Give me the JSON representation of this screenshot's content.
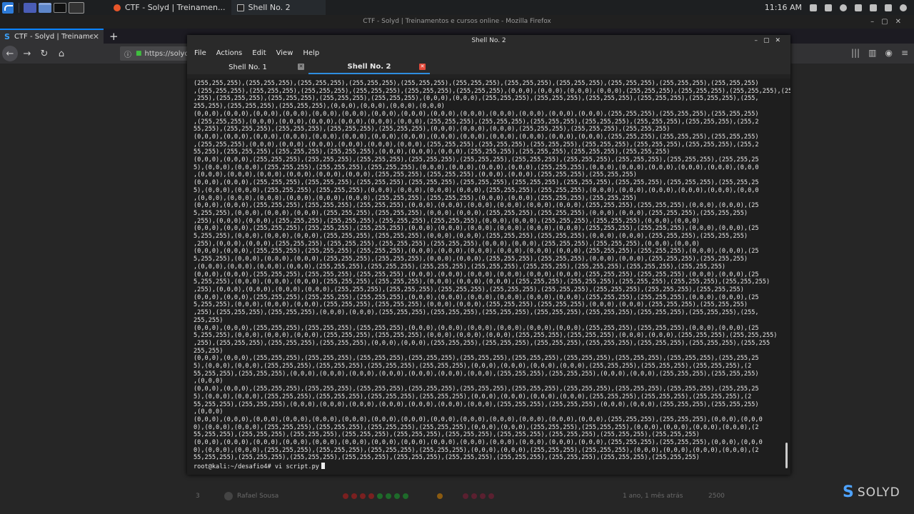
{
  "panel": {
    "tasks": [
      {
        "label": "CTF - Solyd | Treinamen...",
        "icon": "firefox-icon"
      },
      {
        "label": "Shell No. 2",
        "icon": "terminal-icon"
      }
    ],
    "clock": "11:16 AM"
  },
  "firefox": {
    "window_title": "CTF - Solyd | Treinamentos e cursos online - Mozilla Firefox",
    "tab_label": "CTF - Solyd | Treinamen",
    "url": "https://solyd.c",
    "content_row": {
      "rank": "3",
      "user": "Rafael Sousa",
      "time": "1 ano, 1 mês atrás",
      "score": "2500"
    },
    "logo_text": "SOLYD"
  },
  "terminal": {
    "window_title": "Shell No. 2",
    "menu": [
      "File",
      "Actions",
      "Edit",
      "View",
      "Help"
    ],
    "tabs": [
      {
        "label": "Shell No. 1",
        "active": false
      },
      {
        "label": "Shell No. 2",
        "active": true
      }
    ],
    "output": "(255,255,255),(255,255,255),(255,255,255),(255,255,255),(255,255,255),(255,255,255),(255,255,255),(255,255,255),(255,255,255),(255,255,255),(255,255,255)\n,(255,255,255),(255,255,255),(255,255,255),(255,255,255),(255,255,255),(255,255,255),(0,0,0),(0,0,0),(0,0,0),(0,0,0),(255,255,255),(255,255,255),(255,255,255),(255,255\n,255),(255,255,255),(255,255,255),(255,255,255),(255,255,255),(0,0,0),(0,0,0),(255,255,255),(255,255,255),(255,255,255),(255,255,255),(255,255,255),(255,\n255,255),(255,255,255),(255,255,255),(0,0,0),(0,0,0),(0,0,0),(0,0,0)\n(0,0,0),(0,0,0),(0,0,0),(0,0,0),(0,0,0),(0,0,0),(0,0,0),(0,0,0),(0,0,0),(0,0,0),(0,0,0),(0,0,0),(0,0,0),(0,0,0),(255,255,255),(255,255,255),(255,255,255)\n,(255,255,255),(0,0,0),(0,0,0),(0,0,0),(0,0,0),(0,0,0),(0,0,0),(255,255,255),(255,255,255),(255,255,255),(255,255,255),(255,255,255),(255,255,255),(255,2\n55,255),(255,255,255),(255,255,255),(255,255,255),(255,255,255),(0,0,0),(0,0,0),(0,0,0),(255,255,255),(255,255,255),(255,255,255)\n(0,0,0),(0,0,0),(0,0,0),(0,0,0),(0,0,0),(0,0,0),(0,0,0),(0,0,0),(0,0,0),(0,0,0),(0,0,0),(0,0,0),(0,0,0),(0,0,0),(255,255,255),(255,255,255),(255,255,255)\n,(255,255,255),(0,0,0),(0,0,0),(0,0,0),(0,0,0),(0,0,0),(0,0,0),(255,255,255),(255,255,255),(255,255,255),(255,255,255),(255,255,255),(255,255,255),(255,2\n55,255),(255,255,255),(255,255,255),(255,255,255),(0,0,0),(0,0,0),(0,0,0),(255,255,255),(255,255,255),(255,255,255),(255,255,255)\n(0,0,0),(0,0,0),(255,255,255),(255,255,255),(255,255,255),(255,255,255),(255,255,255),(255,255,255),(255,255,255),(255,255,255),(255,255,255),(255,255,25\n5),(0,0,0),(0,0,0),(255,255,255),(255,255,255),(255,255,255),(0,0,0),(0,0,0),(0,0,0),(0,0,0),(255,255,255),(0,0,0),(0,0,0),(0,0,0),(0,0,0),(0,0,0),(0,0,0\n,(0,0,0),(0,0,0),(0,0,0),(0,0,0),(0,0,0),(0,0,0),(255,255,255),(255,255,255),(0,0,0),(0,0,0),(255,255,255),(255,255,255)\n(0,0,0),(0,0,0),(255,255,255),(255,255,255),(255,255,255),(255,255,255),(255,255,255),(255,255,255),(255,255,255),(255,255,255),(255,255,255),(255,255,25\n5),(0,0,0),(0,0,0),(255,255,255),(255,255,255),(0,0,0),(0,0,0),(0,0,0),(0,0,0),(255,255,255),(255,255,255),(0,0,0),(0,0,0),(0,0,0),(0,0,0),(0,0,0),(0,0,0\n,(0,0,0),(0,0,0),(0,0,0),(0,0,0),(0,0,0),(0,0,0),(255,255,255),(255,255,255),(0,0,0),(0,0,0),(255,255,255),(255,255,255)\n(0,0,0),(0,0,0),(255,255,255),(255,255,255),(255,255,255),(0,0,0),(0,0,0),(0,0,0),(0,0,0),(0,0,0),(0,0,0),(255,255,255),(255,255,255),(0,0,0),(0,0,0),(25\n5,255,255),(0,0,0),(0,0,0),(0,0,0),(255,255,255),(255,255,255),(0,0,0),(0,0,0),(255,255,255),(255,255,255),(0,0,0),(0,0,0),(255,255,255),(255,255,255)\n,255),(0,0,0),(0,0,0),(255,255,255),(255,255,255),(255,255,255),(255,255,255),(0,0,0),(0,0,0),(255,255,255),(255,255,255),(0,0,0),(0,0,0)\n(0,0,0),(0,0,0),(255,255,255),(255,255,255),(255,255,255),(0,0,0),(0,0,0),(0,0,0),(0,0,0),(0,0,0),(0,0,0),(255,255,255),(255,255,255),(0,0,0),(0,0,0),(25\n5,255,255),(0,0,0),(0,0,0),(0,0,0),(255,255,255),(255,255,255),(0,0,0),(0,0,0),(255,255,255),(255,255,255),(0,0,0),(0,0,0),(255,255,255),(255,255,255)\n,255),(0,0,0),(0,0,0),(255,255,255),(255,255,255),(255,255,255),(255,255,255),(0,0,0),(0,0,0),(255,255,255),(255,255,255),(0,0,0),(0,0,0)\n(0,0,0),(0,0,0),(255,255,255),(255,255,255),(255,255,255),(0,0,0),(0,0,0),(0,0,0),(0,0,0),(0,0,0),(0,0,0),(255,255,255),(255,255,255),(0,0,0),(0,0,0),(25\n5,255,255),(0,0,0),(0,0,0),(0,0,0),(255,255,255),(255,255,255),(0,0,0),(0,0,0),(255,255,255),(255,255,255),(0,0,0),(0,0,0),(255,255,255),(255,255,255)\n,(0,0,0),(0,0,0),(0,0,0),(0,0,0),(255,255,255),(255,255,255),(255,255,255),(255,255,255),(255,255,255),(255,255,255),(255,255,255),(255,255,255)\n(0,0,0),(0,0,0),(255,255,255),(255,255,255),(255,255,255),(0,0,0),(0,0,0),(0,0,0),(0,0,0),(0,0,0),(0,0,0),(255,255,255),(255,255,255),(0,0,0),(0,0,0),(25\n5,255,255),(0,0,0),(0,0,0),(0,0,0),(255,255,255),(255,255,255),(0,0,0),(0,0,0),(0,0,0),(255,255,255),(255,255,255),(255,255,255),(255,255,255),(255,255,255)\n,255),(0,0,0),(0,0,0),(0,0,0),(0,0,0),(255,255,255),(255,255,255),(255,255,255),(255,255,255),(255,255,255),(255,255,255),(255,255,255),(255,255,255)\n(0,0,0),(0,0,0),(255,255,255),(255,255,255),(255,255,255),(0,0,0),(0,0,0),(0,0,0),(0,0,0),(0,0,0),(0,0,0),(255,255,255),(255,255,255),(0,0,0),(0,0,0),(25\n5,255,255),(0,0,0),(0,0,0),(0,0,0),(255,255,255),(255,255,255),(0,0,0),(0,0,0),(255,255,255),(255,255,255),(0,0,0),(0,0,0),(255,255,255),(255,255,255)\n,255),(255,255,255),(255,255,255),(0,0,0),(0,0,0),(255,255,255),(255,255,255),(255,255,255),(255,255,255),(255,255,255),(255,255,255),(255,255,255),(255,\n255,255)\n(0,0,0),(0,0,0),(255,255,255),(255,255,255),(255,255,255),(0,0,0),(0,0,0),(0,0,0),(0,0,0),(0,0,0),(0,0,0),(255,255,255),(255,255,255),(0,0,0),(0,0,0),(25\n5,255,255),(0,0,0),(0,0,0),(0,0,0),(255,255,255),(255,255,255),(0,0,0),(0,0,0),(0,0,0),(255,255,255),(255,255,255),(0,0,0),(0,0,0),(255,255,255),(255,255,255)\n,255),(255,255,255),(255,255,255),(255,255,255),(0,0,0),(0,0,0),(255,255,255),(255,255,255),(255,255,255),(255,255,255),(255,255,255),(255,255,255),(255,255\n255,255)\n(0,0,0),(0,0,0),(255,255,255),(255,255,255),(255,255,255),(255,255,255),(255,255,255),(255,255,255),(255,255,255),(255,255,255),(255,255,255),(255,255,25\n5),(0,0,0),(0,0,0),(255,255,255),(255,255,255),(255,255,255),(255,255,255),(0,0,0),(0,0,0),(0,0,0),(0,0,0),(255,255,255),(255,255,255),(255,255,255),(2\n55,255,255),(255,255,255),(0,0,0),(0,0,0),(0,0,0),(0,0,0),(0,0,0),(0,0,0),(0,0,0),(255,255,255),(255,255,255),(0,0,0),(0,0,0),(255,255,255),(255,255,255)\n,(0,0,0)\n(0,0,0),(0,0,0),(255,255,255),(255,255,255),(255,255,255),(255,255,255),(255,255,255),(255,255,255),(255,255,255),(255,255,255),(255,255,255),(255,255,25\n5),(0,0,0),(0,0,0),(255,255,255),(255,255,255),(255,255,255),(255,255,255),(0,0,0),(0,0,0),(0,0,0),(0,0,0),(255,255,255),(255,255,255),(255,255,255),(2\n55,255,255),(255,255,255),(0,0,0),(0,0,0),(0,0,0),(0,0,0),(0,0,0),(0,0,0),(0,0,0),(255,255,255),(255,255,255),(0,0,0),(0,0,0),(255,255,255),(255,255,255)\n,(0,0,0)\n(0,0,0),(0,0,0),(0,0,0),(0,0,0),(0,0,0),(0,0,0),(0,0,0),(0,0,0),(0,0,0),(0,0,0),(0,0,0),(0,0,0),(0,0,0),(0,0,0),(255,255,255),(255,255,255),(0,0,0),(0,0,0\n0),(0,0,0),(0,0,0),(255,255,255),(255,255,255),(255,255,255),(255,255,255),(0,0,0),(0,0,0),(255,255,255),(255,255,255),(0,0,0),(0,0,0),(0,0,0),(0,0,0),(2\n55,255,255),(255,255,255),(255,255,255),(255,255,255),(255,255,255),(255,255,255),(255,255,255),(255,255,255),(255,255,255),(255,255,255)\n(0,0,0),(0,0,0),(0,0,0),(0,0,0),(0,0,0),(0,0,0),(0,0,0),(0,0,0),(0,0,0),(0,0,0),(0,0,0),(0,0,0),(0,0,0),(0,0,0),(255,255,255),(255,255,255),(0,0,0),(0,0,0\n0),(0,0,0),(0,0,0),(255,255,255),(255,255,255),(255,255,255),(255,255,255),(0,0,0),(0,0,0),(255,255,255),(255,255,255),(0,0,0),(0,0,0),(0,0,0),(0,0,0),(2\n55,255,255),(255,255,255),(255,255,255),(255,255,255),(255,255,255),(255,255,255),(255,255,255),(255,255,255),(255,255,255),(255,255,255)",
    "prompt": "root@kali:~/desafio4# vi script.py"
  }
}
